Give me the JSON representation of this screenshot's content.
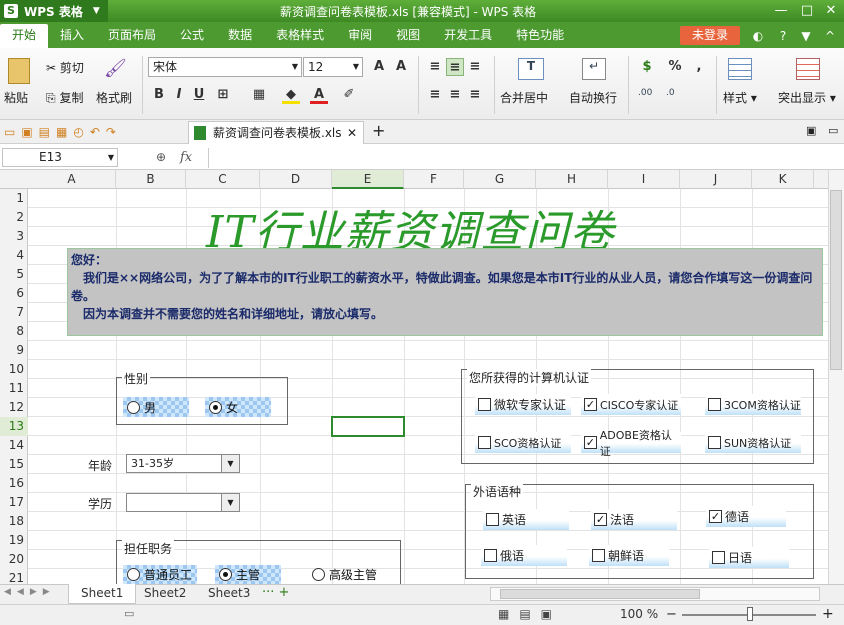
{
  "app": {
    "name": "WPS 表格",
    "doc_title": "薪资调查问卷表模板.xls [兼容模式] - WPS 表格",
    "login": "未登录"
  },
  "menu": [
    "开始",
    "插入",
    "页面布局",
    "公式",
    "数据",
    "表格样式",
    "审阅",
    "视图",
    "开发工具",
    "特色功能"
  ],
  "ribbon": {
    "paste": "粘贴",
    "cut": "剪切",
    "copy": "复制",
    "format_painter": "格式刷",
    "font": "宋体",
    "size": "12",
    "merge": "合并居中",
    "wrap": "自动换行",
    "styles": "样式",
    "highlight": "突出显示"
  },
  "tab": {
    "file": "薪资调查问卷表模板.xls"
  },
  "formula": {
    "cell": "E13",
    "fx": "fx"
  },
  "columns": [
    "A",
    "B",
    "C",
    "D",
    "E",
    "F",
    "G",
    "H",
    "I",
    "J",
    "K"
  ],
  "rows": [
    "1",
    "2",
    "3",
    "4",
    "5",
    "6",
    "7",
    "8",
    "9",
    "10",
    "11",
    "12",
    "13",
    "14",
    "15",
    "16",
    "17",
    "18",
    "19",
    "20",
    "21"
  ],
  "sheet": {
    "title": "IT行业薪资调查问卷",
    "intro": [
      "您好：",
      "　我们是××网络公司，为了了解本市的IT行业职工的薪资水平，特做此调查。如果您是本市IT行业的从业人员，请您合作填写这一份调查问卷。",
      "　因为本调查并不需要您的姓名和详细地址，请放心填写。"
    ],
    "gender": {
      "title": "性别",
      "male": "男",
      "female": "女"
    },
    "age": {
      "label": "年龄",
      "value": "31-35岁"
    },
    "edu": {
      "label": "学历",
      "value": ""
    },
    "position": {
      "title": "担任职务",
      "opt1": "普通员工",
      "opt2": "主管",
      "opt3": "高级主管"
    },
    "cert": {
      "title": "您所获得的计算机认证",
      "items": [
        "微软专家认证",
        "CISCO专家认证",
        "3COM资格认证",
        "SCO资格认证",
        "ADOBE资格认证",
        "SUN资格认证"
      ]
    },
    "lang": {
      "title": "外语语种",
      "items": [
        "英语",
        "法语",
        "德语",
        "俄语",
        "朝鲜语",
        "日语"
      ]
    }
  },
  "sheets": [
    "Sheet1",
    "Sheet2",
    "Sheet3"
  ],
  "status": {
    "zoom": "100 %"
  }
}
